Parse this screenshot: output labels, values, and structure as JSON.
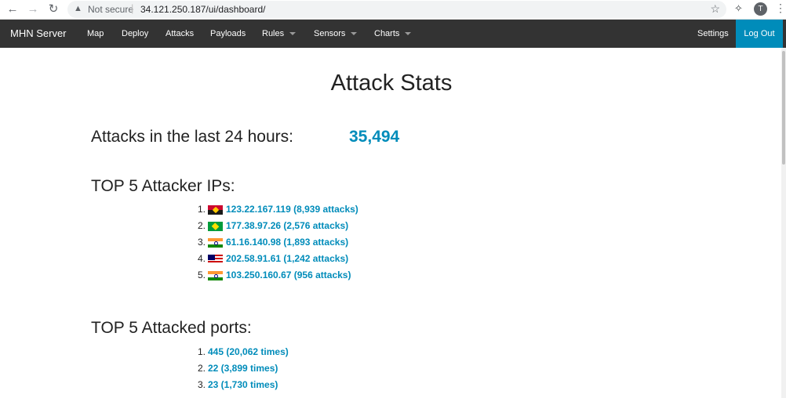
{
  "browser": {
    "security_label": "Not secure",
    "url": "34.121.250.187/ui/dashboard/",
    "profile_initial": "T"
  },
  "navbar": {
    "brand": "MHN Server",
    "items": [
      {
        "label": "Map",
        "dropdown": false
      },
      {
        "label": "Deploy",
        "dropdown": false
      },
      {
        "label": "Attacks",
        "dropdown": false
      },
      {
        "label": "Payloads",
        "dropdown": false
      },
      {
        "label": "Rules",
        "dropdown": true
      },
      {
        "label": "Sensors",
        "dropdown": true
      },
      {
        "label": "Charts",
        "dropdown": true
      }
    ],
    "settings": "Settings",
    "logout": "Log Out"
  },
  "page": {
    "title": "Attack Stats",
    "attacks_24h_label": "Attacks in the last 24 hours:",
    "attacks_24h_value": "35,494",
    "top_ips_title": "TOP 5 Attacker IPs:",
    "top_ips": [
      {
        "rank": "1.",
        "flag": "flag-ao",
        "text": "123.22.167.119 (8,939 attacks)"
      },
      {
        "rank": "2.",
        "flag": "flag-br",
        "text": "177.38.97.26 (2,576 attacks)"
      },
      {
        "rank": "3.",
        "flag": "flag-in",
        "text": "61.16.140.98 (1,893 attacks)"
      },
      {
        "rank": "4.",
        "flag": "flag-my",
        "text": "202.58.91.61 (1,242 attacks)"
      },
      {
        "rank": "5.",
        "flag": "flag-in",
        "text": "103.250.160.67 (956 attacks)"
      }
    ],
    "top_ports_title": "TOP 5 Attacked ports:",
    "top_ports": [
      {
        "rank": "1.",
        "text": "445 (20,062 times)"
      },
      {
        "rank": "2.",
        "text": "22 (3,899 times)"
      },
      {
        "rank": "3.",
        "text": "23 (1,730 times)"
      }
    ]
  },
  "colors": {
    "navbar_bg": "#333333",
    "accent": "#008cba"
  }
}
